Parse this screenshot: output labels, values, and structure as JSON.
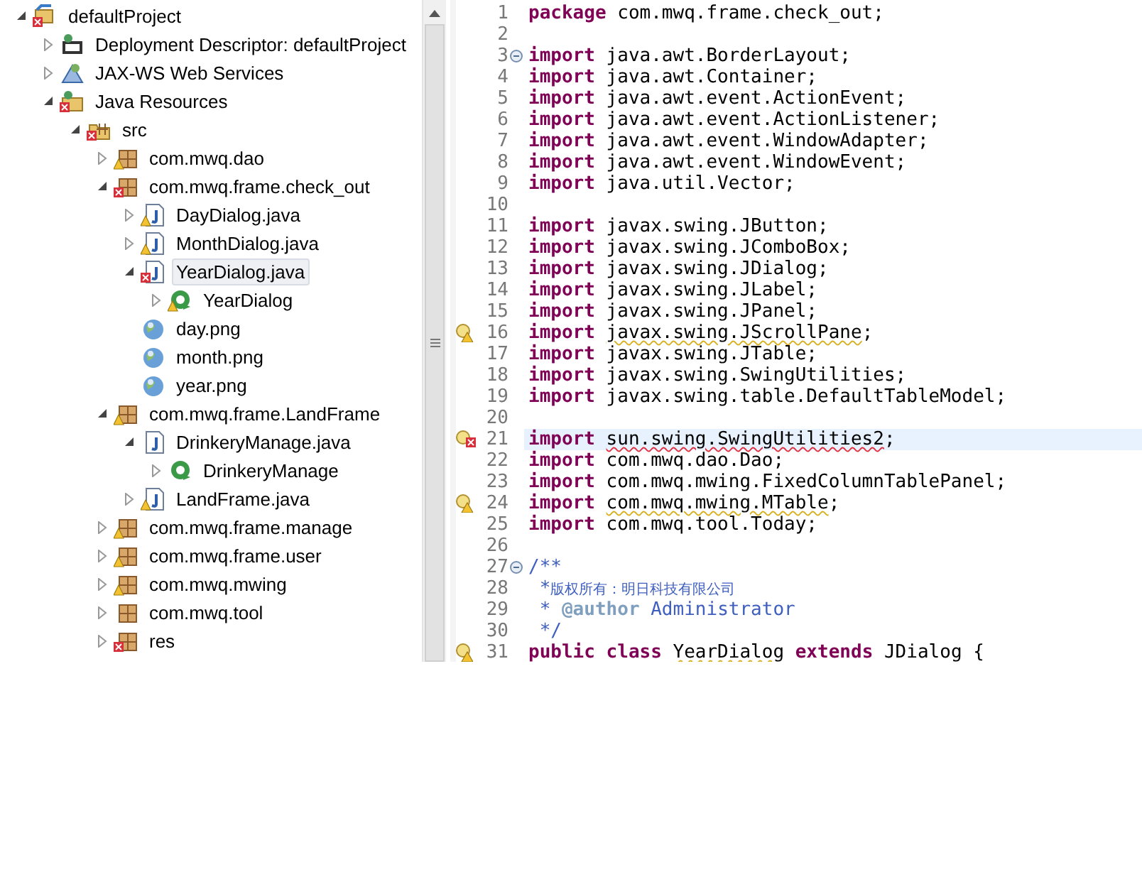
{
  "tree": [
    {
      "label": "defaultProject",
      "kind": "project",
      "error": true,
      "expanded": true,
      "selected": false,
      "children": [
        {
          "label": "Deployment Descriptor: defaultProject",
          "kind": "descriptor",
          "expanded": false,
          "selected": false
        },
        {
          "label": "JAX-WS Web Services",
          "kind": "webservice",
          "expanded": false,
          "selected": false
        },
        {
          "label": "Java Resources",
          "kind": "resources",
          "error": true,
          "expanded": true,
          "selected": false,
          "children": [
            {
              "label": "src",
              "kind": "folder",
              "error": true,
              "expanded": true,
              "selected": false,
              "children": [
                {
                  "label": "com.mwq.dao",
                  "kind": "package",
                  "warning": true,
                  "expanded": false,
                  "selected": false
                },
                {
                  "label": "com.mwq.frame.check_out",
                  "kind": "package",
                  "error": true,
                  "expanded": true,
                  "selected": false,
                  "children": [
                    {
                      "label": "DayDialog.java",
                      "kind": "java",
                      "warning": true,
                      "expanded": false,
                      "selected": false
                    },
                    {
                      "label": "MonthDialog.java",
                      "kind": "java",
                      "warning": true,
                      "expanded": false,
                      "selected": false
                    },
                    {
                      "label": "YearDialog.java",
                      "kind": "java",
                      "error": true,
                      "expanded": true,
                      "selected": true,
                      "children": [
                        {
                          "label": "YearDialog",
                          "kind": "class",
                          "warning": true,
                          "expanded": false,
                          "selected": false
                        }
                      ]
                    },
                    {
                      "label": "day.png",
                      "kind": "image",
                      "selected": false
                    },
                    {
                      "label": "month.png",
                      "kind": "image",
                      "selected": false
                    },
                    {
                      "label": "year.png",
                      "kind": "image",
                      "selected": false
                    }
                  ]
                },
                {
                  "label": "com.mwq.frame.LandFrame",
                  "kind": "package",
                  "warning": true,
                  "expanded": true,
                  "selected": false,
                  "children": [
                    {
                      "label": "DrinkeryManage.java",
                      "kind": "java",
                      "expanded": true,
                      "selected": false,
                      "children": [
                        {
                          "label": "DrinkeryManage",
                          "kind": "class",
                          "expanded": false,
                          "selected": false
                        }
                      ]
                    },
                    {
                      "label": "LandFrame.java",
                      "kind": "java",
                      "warning": true,
                      "expanded": false,
                      "selected": false
                    }
                  ]
                },
                {
                  "label": "com.mwq.frame.manage",
                  "kind": "package",
                  "warning": true,
                  "expanded": false,
                  "selected": false
                },
                {
                  "label": "com.mwq.frame.user",
                  "kind": "package",
                  "warning": true,
                  "expanded": false,
                  "selected": false
                },
                {
                  "label": "com.mwq.mwing",
                  "kind": "package",
                  "warning": true,
                  "expanded": false,
                  "selected": false
                },
                {
                  "label": "com.mwq.tool",
                  "kind": "package",
                  "expanded": false,
                  "selected": false
                },
                {
                  "label": "res",
                  "kind": "package",
                  "error": true,
                  "expanded": false,
                  "selected": false
                }
              ]
            }
          ]
        }
      ]
    }
  ],
  "editor": {
    "lines": [
      {
        "number": "1",
        "tokens": [
          {
            "kind": "keyword",
            "text": "package"
          },
          {
            "kind": "plain",
            "text": " com.mwq.frame.check_out;"
          }
        ]
      },
      {
        "number": "2"
      },
      {
        "number": "3",
        "fold": true,
        "tokens": [
          {
            "kind": "keyword",
            "text": "import"
          },
          {
            "kind": "plain",
            "text": " java.awt.BorderLayout;"
          }
        ]
      },
      {
        "number": "4",
        "tokens": [
          {
            "kind": "keyword",
            "text": "import"
          },
          {
            "kind": "plain",
            "text": " java.awt.Container;"
          }
        ]
      },
      {
        "number": "5",
        "tokens": [
          {
            "kind": "keyword",
            "text": "import"
          },
          {
            "kind": "plain",
            "text": " java.awt.event.ActionEvent;"
          }
        ]
      },
      {
        "number": "6",
        "tokens": [
          {
            "kind": "keyword",
            "text": "import"
          },
          {
            "kind": "plain",
            "text": " java.awt.event.ActionListener;"
          }
        ]
      },
      {
        "number": "7",
        "tokens": [
          {
            "kind": "keyword",
            "text": "import"
          },
          {
            "kind": "plain",
            "text": " java.awt.event.WindowAdapter;"
          }
        ]
      },
      {
        "number": "8",
        "tokens": [
          {
            "kind": "keyword",
            "text": "import"
          },
          {
            "kind": "plain",
            "text": " java.awt.event.WindowEvent;"
          }
        ]
      },
      {
        "number": "9",
        "tokens": [
          {
            "kind": "keyword",
            "text": "import"
          },
          {
            "kind": "plain",
            "text": " java.util.Vector;"
          }
        ]
      },
      {
        "number": "10"
      },
      {
        "number": "11",
        "tokens": [
          {
            "kind": "keyword",
            "text": "import"
          },
          {
            "kind": "plain",
            "text": " javax.swing.JButton;"
          }
        ]
      },
      {
        "number": "12",
        "tokens": [
          {
            "kind": "keyword",
            "text": "import"
          },
          {
            "kind": "plain",
            "text": " javax.swing.JComboBox;"
          }
        ]
      },
      {
        "number": "13",
        "tokens": [
          {
            "kind": "keyword",
            "text": "import"
          },
          {
            "kind": "plain",
            "text": " javax.swing.JDialog;"
          }
        ]
      },
      {
        "number": "14",
        "tokens": [
          {
            "kind": "keyword",
            "text": "import"
          },
          {
            "kind": "plain",
            "text": " javax.swing.JLabel;"
          }
        ]
      },
      {
        "number": "15",
        "tokens": [
          {
            "kind": "keyword",
            "text": "import"
          },
          {
            "kind": "plain",
            "text": " javax.swing.JPanel;"
          }
        ]
      },
      {
        "number": "16",
        "warning": true,
        "tokens": [
          {
            "kind": "keyword",
            "text": "import "
          },
          {
            "kind": "warning",
            "text": "javax.swing.JScrollPane"
          },
          {
            "kind": "plain",
            "text": ";"
          }
        ]
      },
      {
        "number": "17",
        "tokens": [
          {
            "kind": "keyword",
            "text": "import"
          },
          {
            "kind": "plain",
            "text": " javax.swing.JTable;"
          }
        ]
      },
      {
        "number": "18",
        "tokens": [
          {
            "kind": "keyword",
            "text": "import"
          },
          {
            "kind": "plain",
            "text": " javax.swing.SwingUtilities;"
          }
        ]
      },
      {
        "number": "19",
        "tokens": [
          {
            "kind": "keyword",
            "text": "import"
          },
          {
            "kind": "plain",
            "text": " javax.swing.table.DefaultTableModel;"
          }
        ]
      },
      {
        "number": "20"
      },
      {
        "number": "21",
        "warning": true,
        "error": true,
        "current": true,
        "tokens": [
          {
            "kind": "keyword",
            "text": "import "
          },
          {
            "kind": "error",
            "text": "sun.swing.SwingUtilities2"
          },
          {
            "kind": "plain",
            "text": ";"
          }
        ]
      },
      {
        "number": "22",
        "tokens": [
          {
            "kind": "keyword",
            "text": "import"
          },
          {
            "kind": "plain",
            "text": " com.mwq.dao.Dao;"
          }
        ]
      },
      {
        "number": "23",
        "tokens": [
          {
            "kind": "keyword",
            "text": "import"
          },
          {
            "kind": "plain",
            "text": " com.mwq.mwing.FixedColumnTablePanel;"
          }
        ]
      },
      {
        "number": "24",
        "warning": true,
        "tokens": [
          {
            "kind": "keyword",
            "text": "import "
          },
          {
            "kind": "warning",
            "text": "com.mwq.mwing.MTable"
          },
          {
            "kind": "plain",
            "text": ";"
          }
        ]
      },
      {
        "number": "25",
        "tokens": [
          {
            "kind": "keyword",
            "text": "import"
          },
          {
            "kind": "plain",
            "text": " com.mwq.tool.Today;"
          }
        ]
      },
      {
        "number": "26"
      },
      {
        "number": "27",
        "fold": true,
        "tokens": [
          {
            "kind": "javadoc",
            "text": "/**"
          }
        ]
      },
      {
        "number": "28",
        "tokens": [
          {
            "kind": "javadoc",
            "text": " *"
          },
          {
            "kind": "cjk",
            "text": "版权所有：明日科技有限公司"
          }
        ]
      },
      {
        "number": "29",
        "tokens": [
          {
            "kind": "javadoc",
            "text": " * "
          },
          {
            "kind": "tag",
            "text": "@author"
          },
          {
            "kind": "javadoc",
            "text": " Administrator"
          }
        ]
      },
      {
        "number": "30",
        "tokens": [
          {
            "kind": "javadoc",
            "text": " */"
          }
        ]
      },
      {
        "number": "31",
        "warning": true,
        "tokens": [
          {
            "kind": "keyword",
            "text": "public class "
          },
          {
            "kind": "warning",
            "text": "YearDialog"
          },
          {
            "kind": "keyword",
            "text": " extends"
          },
          {
            "kind": "plain",
            "text": " JDialog {"
          }
        ]
      }
    ]
  }
}
